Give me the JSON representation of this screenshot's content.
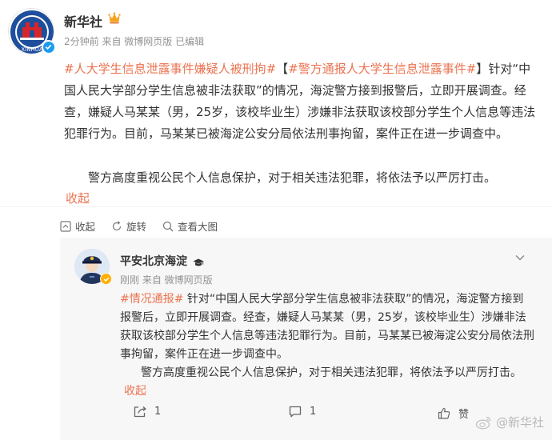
{
  "post": {
    "author": "新华社",
    "meta": "2分钟前  来自 微博网页版 已编辑",
    "tag1": "#人大学生信息泄露事件嫌疑人被刑拘#",
    "bracket_open": "【",
    "tag2": "#警方通报人大学生信息泄露事件#",
    "bracket_close": "】",
    "body1": "针对“中国人民大学部分学生信息被非法获取”的情况，海淀警方接到报警后，立即开展调查。经查，嫌疑人马某某（男，25岁，该校毕业生）涉嫌非法获取该校部分学生个人信息等违法犯罪行为。目前，马某某已被海淀公安分局依法刑事拘留，案件正在进一步调查中。",
    "body2": "警方高度重视公民个人信息保护，对于相关违法犯罪，将依法予以严厉打击。",
    "collapse": "收起"
  },
  "toolbar": {
    "collapse": "收起",
    "rotate": "旋转",
    "view_large": "查看大图"
  },
  "repost": {
    "author": "平安北京海淀",
    "meta": "刚刚  来自 微博网页版",
    "tag": "#情况通报#",
    "body1": " 针对“中国人民大学部分学生信息被非法获取”的情况，海淀警方接到报警后，立即开展调查。经查，嫌疑人马某某（男，25岁，该校毕业生）涉嫌非法获取该校部分学生个人信息等违法犯罪行为。目前，马某某已被海淀公安分局依法刑事拘留，案件正在进一步调查中。",
    "body2": "警方高度重视公民个人信息保护，对于相关违法犯罪，将依法予以严厉打击。",
    "collapse": "收起",
    "repost_count": "1",
    "comment_count": "1",
    "like_count": "赞"
  },
  "watermark": "@新华社",
  "colors": {
    "accent": "#eb7350",
    "verified_blue": "#1d9bf0",
    "verified_gold": "#ffb000",
    "repost_bg": "#f7f7f7"
  }
}
